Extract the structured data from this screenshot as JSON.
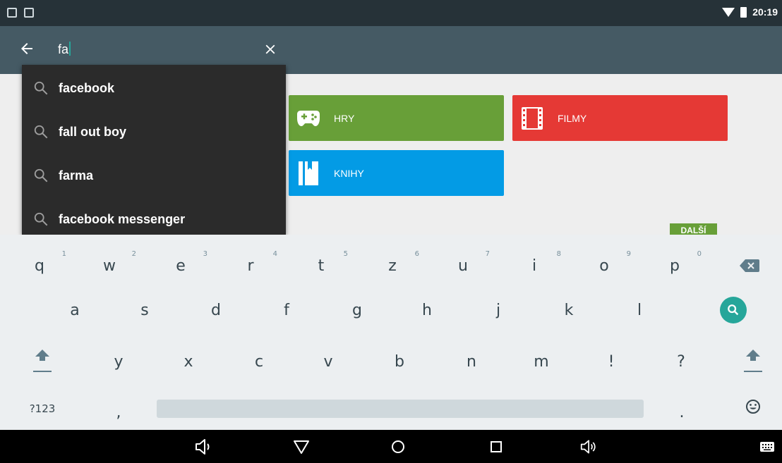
{
  "status_bar": {
    "left_icons": [
      "image-notification-icon",
      "gmail-notification-icon"
    ],
    "time": "20:19",
    "right_icons": [
      "wifi-icon",
      "battery-icon"
    ]
  },
  "search": {
    "query": "fa",
    "back_icon": "arrow-left-icon",
    "clear_icon": "close-icon",
    "accent_color": "#26a69a"
  },
  "suggestions": [
    {
      "text": "facebook",
      "icon": "search-icon"
    },
    {
      "text": "fall out boy",
      "icon": "search-icon"
    },
    {
      "text": "farma",
      "icon": "search-icon"
    },
    {
      "text": "facebook messenger",
      "icon": "search-icon"
    }
  ],
  "categories": [
    {
      "label": "HRY",
      "icon": "gamepad-icon",
      "color": "#689f38"
    },
    {
      "label": "FILMY",
      "icon": "film-icon",
      "color": "#e53935"
    },
    {
      "label": "KNIHY",
      "icon": "book-icon",
      "color": "#039be5"
    }
  ],
  "more_button": {
    "label": "DALŠÍ"
  },
  "keyboard": {
    "row1": [
      {
        "key": "q",
        "hint": "1"
      },
      {
        "key": "w",
        "hint": "2"
      },
      {
        "key": "e",
        "hint": "3"
      },
      {
        "key": "r",
        "hint": "4"
      },
      {
        "key": "t",
        "hint": "5"
      },
      {
        "key": "z",
        "hint": "6"
      },
      {
        "key": "u",
        "hint": "7"
      },
      {
        "key": "i",
        "hint": "8"
      },
      {
        "key": "o",
        "hint": "9"
      },
      {
        "key": "p",
        "hint": "0"
      }
    ],
    "row2": [
      "a",
      "s",
      "d",
      "f",
      "g",
      "h",
      "j",
      "k",
      "l"
    ],
    "row3": [
      "y",
      "x",
      "c",
      "v",
      "b",
      "n",
      "m",
      "!",
      "?"
    ],
    "symbols_key": "?123",
    "comma_key": ",",
    "period_key": ".",
    "backspace_icon": "backspace-icon",
    "search_key_icon": "search-icon",
    "shift_icon": "shift-icon",
    "emoji_icon": "emoji-icon"
  },
  "nav_bar": {
    "buttons": [
      "volume-down-icon",
      "back-icon",
      "home-icon",
      "recents-icon",
      "volume-up-icon",
      "keyboard-icon"
    ]
  }
}
